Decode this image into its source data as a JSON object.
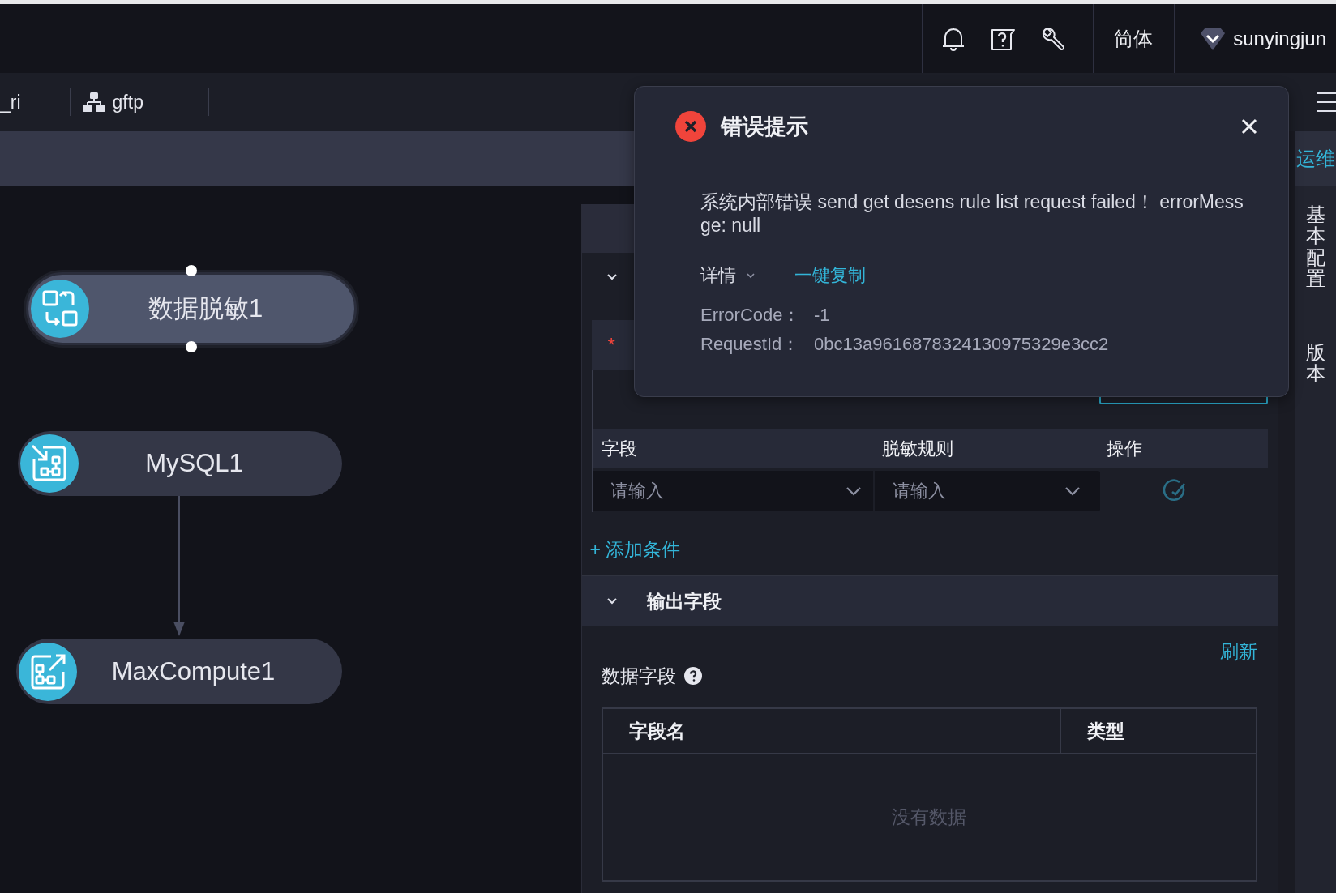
{
  "top_bar": {
    "language": "简体",
    "user": "sunyingjun"
  },
  "tabs": [
    {
      "label": "_ri",
      "icon": false
    },
    {
      "label": "gftp",
      "icon": true
    }
  ],
  "side_tabs": [
    {
      "label": "运维",
      "selected": true
    },
    {
      "label": "基本配置",
      "selected": false
    },
    {
      "label": "版本",
      "selected": false
    }
  ],
  "canvas": {
    "nodes": [
      {
        "label": "数据脱敏1",
        "kind": "masking",
        "selected": true
      },
      {
        "label": "MySQL1",
        "kind": "source",
        "selected": false
      },
      {
        "label": "MaxCompute1",
        "kind": "sink",
        "selected": false
      }
    ]
  },
  "panel": {
    "section_expanded": true,
    "required_mark": "*",
    "rules_table": {
      "columns": [
        "字段",
        "脱敏规则",
        "操作"
      ],
      "rows": [
        {
          "field": {
            "placeholder": "请输入"
          },
          "rule": {
            "placeholder": "请输入"
          }
        }
      ]
    },
    "add_link": "+ 添加条件",
    "output_section": {
      "title": "输出字段",
      "expanded": true,
      "refresh": "刷新",
      "label": "数据字段",
      "table": {
        "columns": [
          "字段名",
          "类型"
        ],
        "empty_text": "没有数据"
      }
    }
  },
  "dialog": {
    "title": "错误提示",
    "message_lines": [
      "系统内部错误 send get desens rule list request failed！ errorMess",
      "ge: null"
    ],
    "details": {
      "label": "详情",
      "expanded": false
    },
    "copy_link": "一键复制",
    "fields": [
      {
        "label": "ErrorCode：",
        "value": "-1"
      },
      {
        "label": "RequestId：",
        "value": "0bc13a9616878324130975329e3cc2"
      }
    ]
  }
}
